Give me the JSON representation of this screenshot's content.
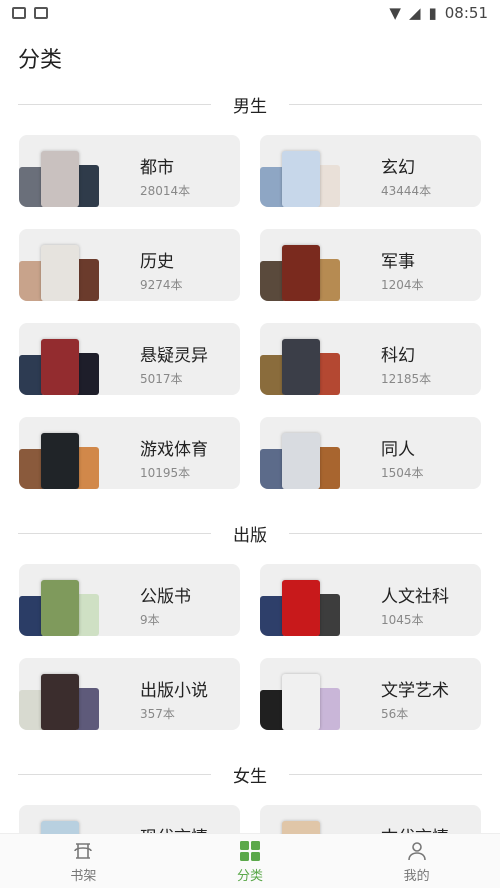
{
  "status": {
    "time": "08:51"
  },
  "page": {
    "title": "分类"
  },
  "sections": {
    "male": {
      "title": "男生",
      "items": [
        {
          "name": "都市",
          "count": "28014本",
          "colors": [
            "#6a6f7a",
            "#c9c1bf",
            "#2f3b4a"
          ]
        },
        {
          "name": "玄幻",
          "count": "43444本",
          "colors": [
            "#8ea6c4",
            "#c7d7ea",
            "#e9e0d8"
          ]
        },
        {
          "name": "历史",
          "count": "9274本",
          "colors": [
            "#c8a38b",
            "#e6e3de",
            "#6b3b2c"
          ]
        },
        {
          "name": "军事",
          "count": "1204本",
          "colors": [
            "#5a4a3c",
            "#7a2a1e",
            "#b68b52"
          ]
        },
        {
          "name": "悬疑灵异",
          "count": "5017本",
          "colors": [
            "#2d3b52",
            "#932c2f",
            "#1e1e2a"
          ]
        },
        {
          "name": "科幻",
          "count": "12185本",
          "colors": [
            "#8a6c3c",
            "#3b3e48",
            "#b44832"
          ]
        },
        {
          "name": "游戏体育",
          "count": "10195本",
          "colors": [
            "#8a5a3c",
            "#202428",
            "#d1884a"
          ]
        },
        {
          "name": "同人",
          "count": "1504本",
          "colors": [
            "#5c6b8a",
            "#d8dbe0",
            "#a8652f"
          ]
        }
      ]
    },
    "publish": {
      "title": "出版",
      "items": [
        {
          "name": "公版书",
          "count": "9本",
          "colors": [
            "#2b3d66",
            "#7f9a5c",
            "#cfe0c4"
          ]
        },
        {
          "name": "人文社科",
          "count": "1045本",
          "colors": [
            "#2e3f6a",
            "#c8191b",
            "#3d3d3d"
          ]
        },
        {
          "name": "出版小说",
          "count": "357本",
          "colors": [
            "#d8dad0",
            "#3b2d2d",
            "#5e5a7a"
          ]
        },
        {
          "name": "文学艺术",
          "count": "56本",
          "colors": [
            "#202020",
            "#f0f0f0",
            "#c9b6d8"
          ]
        }
      ]
    },
    "female": {
      "title": "女生",
      "items": [
        {
          "name": "现代言情",
          "count": "",
          "colors": [
            "#d8c4b0",
            "#b8d0e0",
            "#e0c4c8"
          ]
        },
        {
          "name": "古代言情",
          "count": "",
          "colors": [
            "#b83a3a",
            "#e0c6a8",
            "#8a5a6a"
          ]
        }
      ]
    }
  },
  "tabs": [
    {
      "label": "书架",
      "icon": "bookshelf-icon"
    },
    {
      "label": "分类",
      "icon": "grid-icon"
    },
    {
      "label": "我的",
      "icon": "user-icon"
    }
  ],
  "accent": "#5ba84a"
}
